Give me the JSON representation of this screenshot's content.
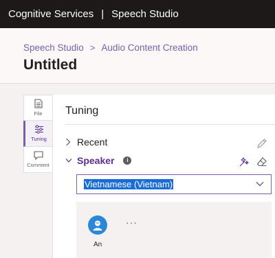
{
  "topbar": {
    "brand": "Cognitive Services",
    "separator": "|",
    "product": "Speech Studio"
  },
  "breadcrumb": {
    "root": "Speech Studio",
    "separator": ">",
    "current": "Audio Content Creation"
  },
  "page": {
    "title": "Untitled"
  },
  "rail": [
    {
      "label": "File",
      "icon": "file-icon",
      "active": false
    },
    {
      "label": "Tuning",
      "icon": "sliders-icon",
      "active": true
    },
    {
      "label": "Comment",
      "icon": "comment-icon",
      "active": false
    }
  ],
  "panel": {
    "title": "Tuning",
    "sections": {
      "recent": "Recent",
      "speaker": "Speaker"
    },
    "speaker_info_glyph": "i",
    "language_select": {
      "value": "Vietnamese (Vietnam)"
    },
    "voices": [
      {
        "name": "An"
      }
    ],
    "more_label": "···"
  },
  "colors": {
    "accent": "#7a5fa6",
    "topbar": "#1b1a19",
    "selection": "#1a6dd8",
    "avatar": "#2b88d8"
  }
}
